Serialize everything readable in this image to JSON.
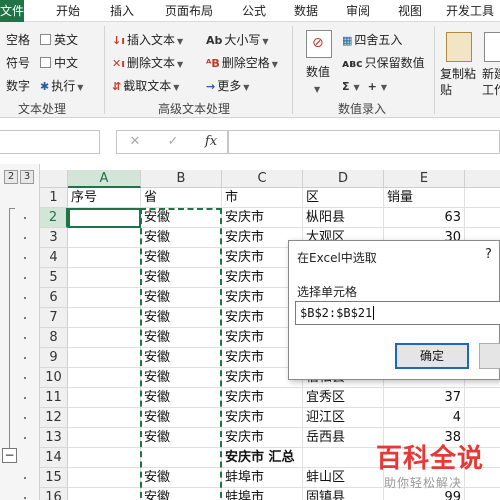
{
  "tabs": [
    "文件",
    "开始",
    "插入",
    "页面布局",
    "公式",
    "数据",
    "审阅",
    "视图",
    "开发工具"
  ],
  "ribbon": {
    "checkbox_items": {
      "kongge": "空格",
      "yingwen": "英文",
      "fuhao": "符号",
      "zhongwen": "中文",
      "shuzi": "数字",
      "zhixing": "执行"
    },
    "text_tools": {
      "insert": "插入文本",
      "delete": "删除文本",
      "extract": "截取文本",
      "case": "大小写",
      "delete_space": "删除空格",
      "more": "更多"
    },
    "number_tools": {
      "numeric": "数值",
      "round": "四舍五入",
      "keep_digits": "只保留数值"
    },
    "paste_tools": {
      "copy_paste": "复制粘贴",
      "new_workbook": "新建工作"
    },
    "group_labels": {
      "text_processing": "文本处理",
      "advanced_text": "高级文本处理",
      "number_input": "数值录入"
    }
  },
  "formula_bar": {
    "fx": "fx",
    "cancel": "✕",
    "confirm": "✓"
  },
  "outline": {
    "levels": [
      "2",
      "3"
    ],
    "collapse": "−"
  },
  "columns": [
    "A",
    "B",
    "C",
    "D",
    "E"
  ],
  "rows": [
    {
      "n": "1",
      "a": "序号",
      "b": "省",
      "c": "市",
      "d": "区",
      "e": "销量"
    },
    {
      "n": "2",
      "a": "",
      "b": "安徽",
      "c": "安庆市",
      "d": "枞阳县",
      "e": "63"
    },
    {
      "n": "3",
      "a": "",
      "b": "安徽",
      "c": "安庆市",
      "d": "大观区",
      "e": "30"
    },
    {
      "n": "4",
      "a": "",
      "b": "安徽",
      "c": "安庆市",
      "d": "",
      "e": ""
    },
    {
      "n": "5",
      "a": "",
      "b": "安徽",
      "c": "安庆市",
      "d": "",
      "e": ""
    },
    {
      "n": "6",
      "a": "",
      "b": "安徽",
      "c": "安庆市",
      "d": "",
      "e": ""
    },
    {
      "n": "7",
      "a": "",
      "b": "安徽",
      "c": "安庆市",
      "d": "",
      "e": ""
    },
    {
      "n": "8",
      "a": "",
      "b": "安徽",
      "c": "安庆市",
      "d": "",
      "e": ""
    },
    {
      "n": "9",
      "a": "",
      "b": "安徽",
      "c": "安庆市",
      "d": "",
      "e": ""
    },
    {
      "n": "10",
      "a": "",
      "b": "安徽",
      "c": "安庆市",
      "d": "宿松县",
      "e": ""
    },
    {
      "n": "11",
      "a": "",
      "b": "安徽",
      "c": "安庆市",
      "d": "宜秀区",
      "e": "37"
    },
    {
      "n": "12",
      "a": "",
      "b": "安徽",
      "c": "安庆市",
      "d": "迎江区",
      "e": "4"
    },
    {
      "n": "13",
      "a": "",
      "b": "安徽",
      "c": "安庆市",
      "d": "岳西县",
      "e": "38"
    },
    {
      "n": "14",
      "a": "",
      "b": "",
      "c": "安庆市 汇总",
      "d": "",
      "e": ""
    },
    {
      "n": "15",
      "a": "",
      "b": "安徽",
      "c": "蚌埠市",
      "d": "蚌山区",
      "e": ""
    },
    {
      "n": "16",
      "a": "",
      "b": "安徽",
      "c": "蚌埠市",
      "d": "固镇县",
      "e": "99"
    }
  ],
  "dialog": {
    "title": "在Excel中选取",
    "help": "?",
    "label": "选择单元格",
    "value": "$B$2:$B$21",
    "ok": "确定"
  },
  "watermark": {
    "main": "百科全说",
    "sub": "助你轻松解决"
  }
}
